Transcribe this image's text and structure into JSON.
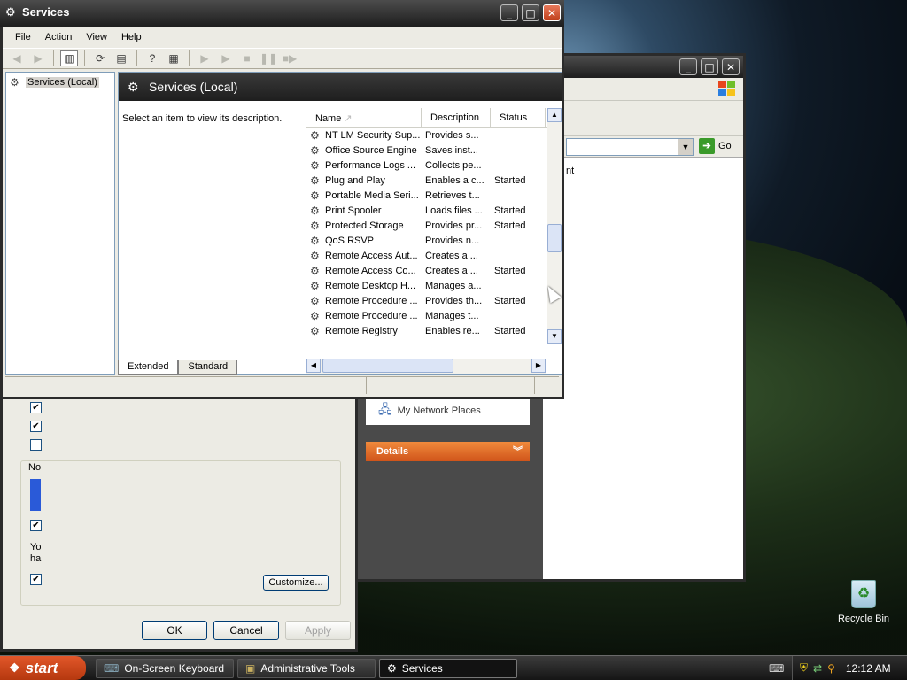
{
  "services_window": {
    "title": "Services",
    "menu": [
      "File",
      "Action",
      "View",
      "Help"
    ],
    "tree_root": "Services (Local)",
    "header": "Services (Local)",
    "description_prompt": "Select an item to view its description.",
    "columns": [
      "Name",
      "Description",
      "Status"
    ],
    "rows": [
      {
        "name": "NT LM Security Sup...",
        "description": "Provides s...",
        "status": ""
      },
      {
        "name": "Office Source Engine",
        "description": "Saves inst...",
        "status": ""
      },
      {
        "name": "Performance Logs ...",
        "description": "Collects pe...",
        "status": ""
      },
      {
        "name": "Plug and Play",
        "description": "Enables a c...",
        "status": "Started"
      },
      {
        "name": "Portable Media Seri...",
        "description": "Retrieves t...",
        "status": ""
      },
      {
        "name": "Print Spooler",
        "description": "Loads files ...",
        "status": "Started"
      },
      {
        "name": "Protected Storage",
        "description": "Provides pr...",
        "status": "Started"
      },
      {
        "name": "QoS RSVP",
        "description": "Provides n...",
        "status": ""
      },
      {
        "name": "Remote Access Aut...",
        "description": "Creates a ...",
        "status": ""
      },
      {
        "name": "Remote Access Co...",
        "description": "Creates a ...",
        "status": "Started"
      },
      {
        "name": "Remote Desktop H...",
        "description": "Manages a...",
        "status": ""
      },
      {
        "name": "Remote Procedure ...",
        "description": "Provides th...",
        "status": "Started"
      },
      {
        "name": "Remote Procedure ...",
        "description": "Manages t...",
        "status": ""
      },
      {
        "name": "Remote Registry",
        "description": "Enables re...",
        "status": "Started"
      }
    ],
    "tabs": {
      "extended": "Extended",
      "standard": "Standard"
    }
  },
  "explorer_window": {
    "go_label": "Go",
    "partial_text": "nt",
    "network_places": "My Network Places",
    "details_label": "Details"
  },
  "props_dialog": {
    "ok": "OK",
    "cancel": "Cancel",
    "apply": "Apply",
    "customize": "Customize...",
    "partial_no": "No",
    "partial_y": "Yo",
    "partial_h": "ha"
  },
  "desktop": {
    "recycle_bin": "Recycle Bin"
  },
  "taskbar": {
    "start": "start",
    "tasks": [
      "On-Screen Keyboard",
      "Administrative Tools",
      "Services"
    ],
    "clock": "12:12 AM"
  }
}
